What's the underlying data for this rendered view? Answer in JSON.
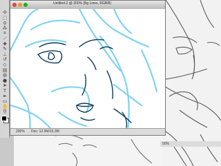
{
  "main_window": {
    "title": "Untitled-2 @ 200% (Bg Lines, RGB/8)",
    "zoom": "200%",
    "doc_info": "Doc: 12.9M/16.3M"
  },
  "right_window": {
    "zoom": "50%"
  },
  "tools": {
    "items": [
      {
        "name": "move-tool-icon",
        "glyph": "✢"
      },
      {
        "name": "marquee-tool-icon",
        "glyph": "⬚"
      },
      {
        "name": "lasso-tool-icon",
        "glyph": "ϙ"
      },
      {
        "name": "wand-tool-icon",
        "glyph": "⁂"
      },
      {
        "name": "crop-tool-icon",
        "glyph": "⌗"
      },
      {
        "name": "slice-tool-icon",
        "glyph": "⟋"
      },
      {
        "name": "heal-tool-icon",
        "glyph": "✚"
      },
      {
        "name": "brush-tool-icon",
        "glyph": "✎"
      },
      {
        "name": "stamp-tool-icon",
        "glyph": "⊥"
      },
      {
        "name": "history-brush-icon",
        "glyph": "↺"
      },
      {
        "name": "eraser-tool-icon",
        "glyph": "◇"
      },
      {
        "name": "gradient-tool-icon",
        "glyph": "▤"
      },
      {
        "name": "blur-tool-icon",
        "glyph": "◍"
      },
      {
        "name": "dodge-tool-icon",
        "glyph": "●"
      },
      {
        "name": "path-tool-icon",
        "glyph": "➤"
      },
      {
        "name": "type-tool-icon",
        "glyph": "T"
      },
      {
        "name": "pen-tool-icon",
        "glyph": "✒"
      },
      {
        "name": "shape-tool-icon",
        "glyph": "▭"
      },
      {
        "name": "hand-tool-icon",
        "glyph": "✋"
      },
      {
        "name": "zoom-tool-icon",
        "glyph": "⚲"
      }
    ],
    "foreground_color": "#000000",
    "background_color": "#ffffff"
  },
  "colors": {
    "sketch_line": "#7fd3f0",
    "ink_line": "#0c3a5a",
    "bg_sketch_line": "#5a5a5a"
  }
}
